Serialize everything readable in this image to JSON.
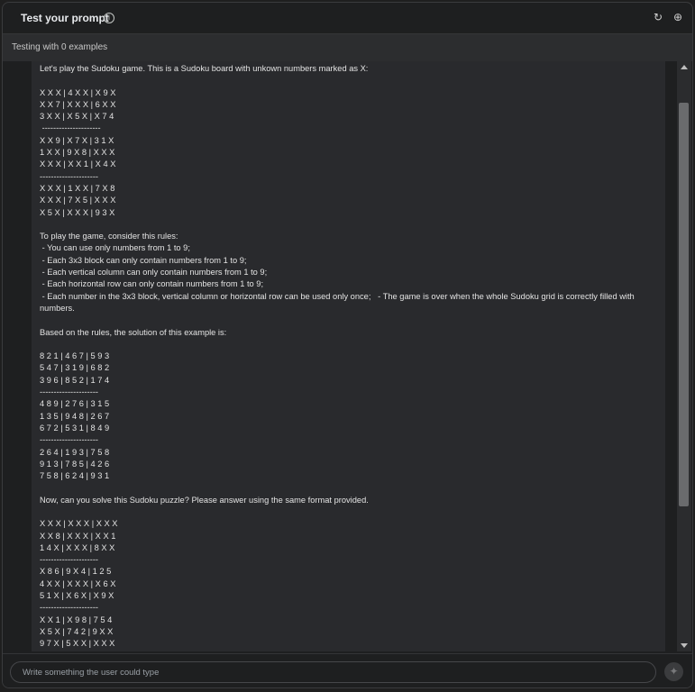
{
  "header": {
    "title": "Test your prompt",
    "info_icon": "info-icon",
    "refresh_icon": "refresh-icon",
    "add_icon": "add-circle-icon"
  },
  "subheader": {
    "text": "Testing with 0 examples"
  },
  "prompt": {
    "text": "Let's play the Sudoku game. This is a Sudoku board with unkown numbers marked as X:\n\nX X X | 4 X X | X 9 X\nX X 7 | X X X | 6 X X\n3 X X | X 5 X | X 7 4\n ---------------------\nX X 9 | X 7 X | 3 1 X\n1 X X | 9 X 8 | X X X\nX X X | X X 1 | X 4 X\n---------------------\nX X X | 1 X X | 7 X 8\nX X X | 7 X 5 | X X X\nX 5 X | X X X | 9 3 X\n\nTo play the game, consider this rules:\n - You can use only numbers from 1 to 9;\n - Each 3x3 block can only contain numbers from 1 to 9;\n - Each vertical column can only contain numbers from 1 to 9;\n - Each horizontal row can only contain numbers from 1 to 9;\n - Each number in the 3x3 block, vertical column or horizontal row can be used only once;   - The game is over when the whole Sudoku grid is correctly filled with numbers.\n\nBased on the rules, the solution of this example is:\n\n8 2 1 | 4 6 7 | 5 9 3\n5 4 7 | 3 1 9 | 6 8 2\n3 9 6 | 8 5 2 | 1 7 4\n---------------------\n4 8 9 | 2 7 6 | 3 1 5\n1 3 5 | 9 4 8 | 2 6 7\n6 7 2 | 5 3 1 | 8 4 9\n---------------------\n2 6 4 | 1 9 3 | 7 5 8\n9 1 3 | 7 8 5 | 4 2 6\n7 5 8 | 6 2 4 | 9 3 1\n\nNow, can you solve this Sudoku puzzle? Please answer using the same format provided.\n\nX X X | X X X | X X X\nX X 8 | X X X | X X 1\n1 4 X | X X X | 8 X X\n---------------------\nX 8 6 | 9 X 4 | 1 2 5\n4 X X | X X X | X 6 X\n5 1 X | X 6 X | X 9 X\n---------------------\nX X 1 | X 9 8 | 7 5 4\nX 5 X | 7 4 2 | 9 X X\n9 7 X | 5 X X | X X X"
  },
  "input": {
    "placeholder": "Write something the user could type",
    "send_icon": "send-sparkle-icon"
  }
}
